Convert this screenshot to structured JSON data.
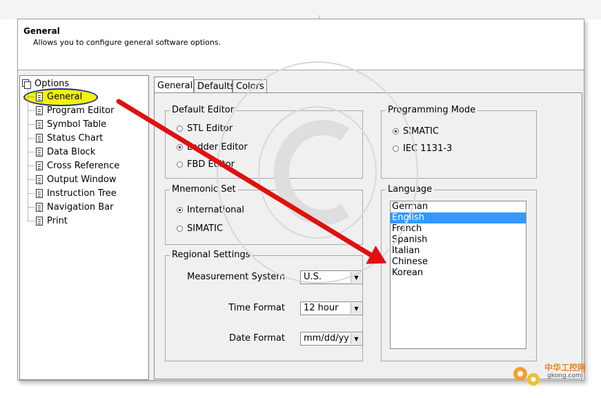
{
  "header": {
    "title": "General",
    "description": "Allows you to configure general software options."
  },
  "tree": {
    "root": "Options",
    "items": [
      {
        "label": "General",
        "selected": true
      },
      {
        "label": "Program Editor"
      },
      {
        "label": "Symbol Table"
      },
      {
        "label": "Status Chart"
      },
      {
        "label": "Data Block"
      },
      {
        "label": "Cross Reference"
      },
      {
        "label": "Output Window"
      },
      {
        "label": "Instruction Tree"
      },
      {
        "label": "Navigation Bar"
      },
      {
        "label": "Print"
      }
    ]
  },
  "tabs": [
    "General",
    "Defaults",
    "Colors"
  ],
  "default_editor": {
    "title": "Default Editor",
    "options": [
      "STL Editor",
      "Ladder Editor",
      "FBD Editor"
    ],
    "selected": "Ladder Editor"
  },
  "programming_mode": {
    "title": "Programming Mode",
    "options": [
      "SIMATIC",
      "IEC 1131-3"
    ],
    "selected": "SIMATIC"
  },
  "mnemonic_set": {
    "title": "Mnemonic Set",
    "options": [
      "International",
      "SIMATIC"
    ],
    "selected": "International"
  },
  "regional": {
    "title": "Regional Settings",
    "measurement_label": "Measurement System",
    "measurement_value": "U.S.",
    "time_label": "Time Format",
    "time_value": "12 hour",
    "date_label": "Date Format",
    "date_value": "mm/dd/yy"
  },
  "language": {
    "title": "Language",
    "items": [
      "German",
      "English",
      "French",
      "Spanish",
      "Italian",
      "Chinese",
      "Korean"
    ],
    "selected": "English"
  },
  "colors": {
    "highlight": "#3399ff",
    "annotation_arrow": "#e01010",
    "annotation_oval": "#f4f20a"
  },
  "logo": {
    "line1": "中华工控网",
    "line2": "gkong.com"
  }
}
